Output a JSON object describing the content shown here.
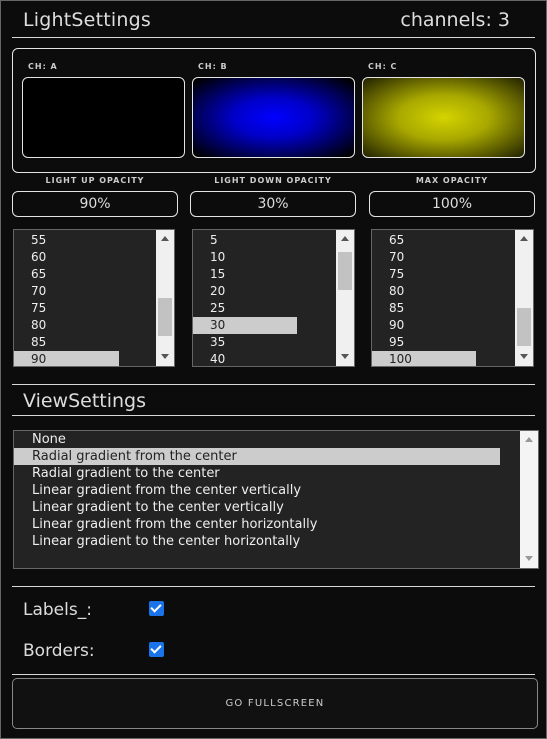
{
  "header": {
    "title": "LightSettings",
    "channels_label": "channels: 3"
  },
  "channels": [
    {
      "label": "CH: A",
      "color": "#000000"
    },
    {
      "label": "CH: B",
      "color": "#0000ff"
    },
    {
      "label": "CH: C",
      "color": "#d4d400"
    }
  ],
  "opacity": [
    {
      "label": "LIGHT UP OPACITY",
      "value": "90%"
    },
    {
      "label": "LIGHT DOWN OPACITY",
      "value": "30%"
    },
    {
      "label": "MAX OPACITY",
      "value": "100%"
    }
  ],
  "lists": [
    {
      "items": [
        "55",
        "60",
        "65",
        "70",
        "75",
        "80",
        "85",
        "90"
      ],
      "selected": "90"
    },
    {
      "items": [
        "5",
        "10",
        "15",
        "20",
        "25",
        "30",
        "35",
        "40"
      ],
      "selected": "30"
    },
    {
      "items": [
        "65",
        "70",
        "75",
        "80",
        "85",
        "90",
        "95",
        "100"
      ],
      "selected": "100"
    }
  ],
  "view_settings": {
    "title": "ViewSettings",
    "options": [
      "None",
      "Radial gradient from the center",
      "Radial gradient to the center",
      "Linear gradient from the center vertically",
      "Linear gradient to the center vertically",
      "Linear gradient from the center horizontally",
      "Linear gradient to the center horizontally"
    ],
    "selected": "Radial gradient from the center"
  },
  "options": {
    "labels": {
      "label": "Labels_:",
      "checked": true
    },
    "borders": {
      "label": "Borders:",
      "checked": true
    }
  },
  "fullscreen_button": "GO FULLSCREEN",
  "colors": {
    "accent": "#1a73e8",
    "background": "#0c0c0c",
    "selection": "#cccccc"
  }
}
